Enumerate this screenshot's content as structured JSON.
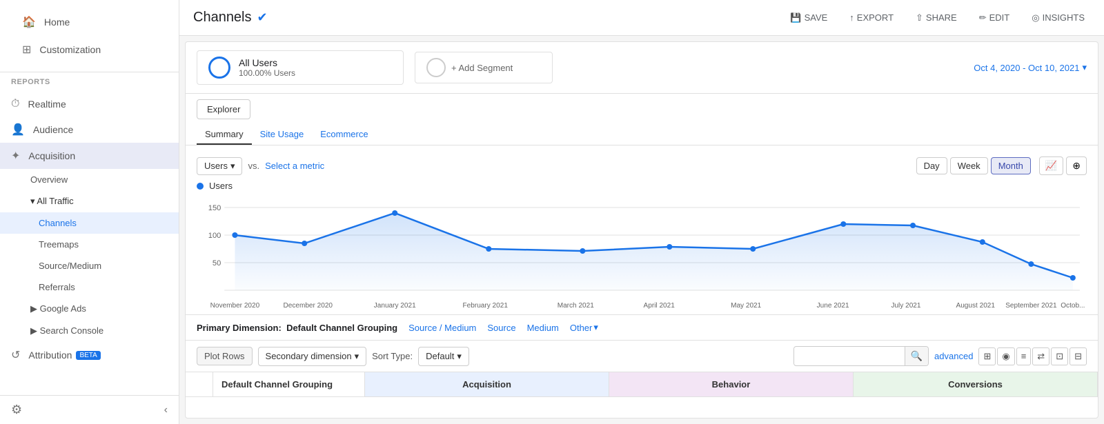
{
  "sidebar": {
    "home_label": "Home",
    "customization_label": "Customization",
    "reports_label": "REPORTS",
    "realtime_label": "Realtime",
    "audience_label": "Audience",
    "acquisition_label": "Acquisition",
    "acquisition_sub": {
      "overview": "Overview",
      "all_traffic": "All Traffic",
      "channels": "Channels",
      "treemaps": "Treemaps",
      "source_medium": "Source/Medium",
      "referrals": "Referrals",
      "google_ads": "Google Ads",
      "search_console": "Search Console",
      "attribution": "Attribution",
      "attribution_badge": "BETA"
    }
  },
  "topbar": {
    "title": "Channels",
    "save": "SAVE",
    "export": "EXPORT",
    "share": "SHARE",
    "edit": "EDIT",
    "insights": "INSIGHTS"
  },
  "segment": {
    "all_users_label": "All Users",
    "all_users_pct": "100.00% Users",
    "add_segment": "+ Add Segment",
    "date_range": "Oct 4, 2020 - Oct 10, 2021"
  },
  "explorer": {
    "tab_label": "Explorer",
    "sub_tabs": [
      "Summary",
      "Site Usage",
      "Ecommerce"
    ]
  },
  "chart": {
    "metric_label": "Users",
    "vs_label": "vs.",
    "select_metric": "Select a metric",
    "time_buttons": [
      "Day",
      "Week",
      "Month"
    ],
    "active_time": "Month",
    "y_labels": [
      "150",
      "100",
      "50"
    ],
    "x_labels": [
      "November 2020",
      "December 2020",
      "January 2021",
      "February 2021",
      "March 2021",
      "April 2021",
      "May 2021",
      "June 2021",
      "July 2021",
      "August 2021",
      "September 2021",
      "Octob..."
    ],
    "legend": "Users",
    "chart_color": "#1a73e8"
  },
  "primary_dim": {
    "label": "Primary Dimension:",
    "active": "Default Channel Grouping",
    "links": [
      "Source / Medium",
      "Source",
      "Medium",
      "Other"
    ]
  },
  "table_toolbar": {
    "plot_rows": "Plot Rows",
    "secondary_dim": "Secondary dimension",
    "sort_type_label": "Sort Type:",
    "sort_default": "Default",
    "search_placeholder": "",
    "advanced": "advanced"
  },
  "table_headers": {
    "col1": "",
    "col2": "Default Channel Grouping",
    "acquisition": "Acquisition",
    "behavior": "Behavior",
    "conversions": "Conversions"
  }
}
